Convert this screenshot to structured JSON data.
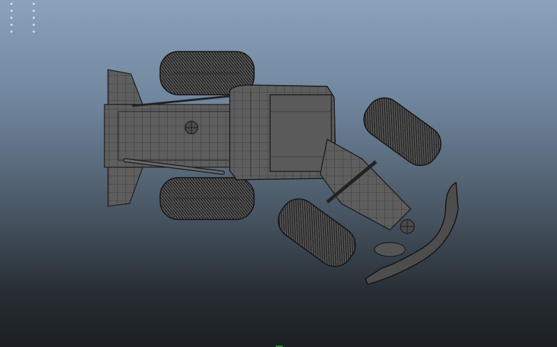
{
  "viewport": {
    "title": "",
    "background_top": "#8aa2bb",
    "background_bottom": "#1b1f23",
    "mesh_fill": "#5c5c5c",
    "wire_color": "#1a1a1a",
    "display_mode": "wireframe-on-shaded",
    "view": "top"
  },
  "scene": {
    "object": "motor-grader-model",
    "parts": [
      "rear-tire-left",
      "rear-tire-right",
      "rear-frame",
      "cab",
      "front-tire-left",
      "front-tire-right",
      "front-axle",
      "front-blade"
    ]
  },
  "icons": [
    "panel-grip-icon",
    "panel-grip-icon"
  ]
}
